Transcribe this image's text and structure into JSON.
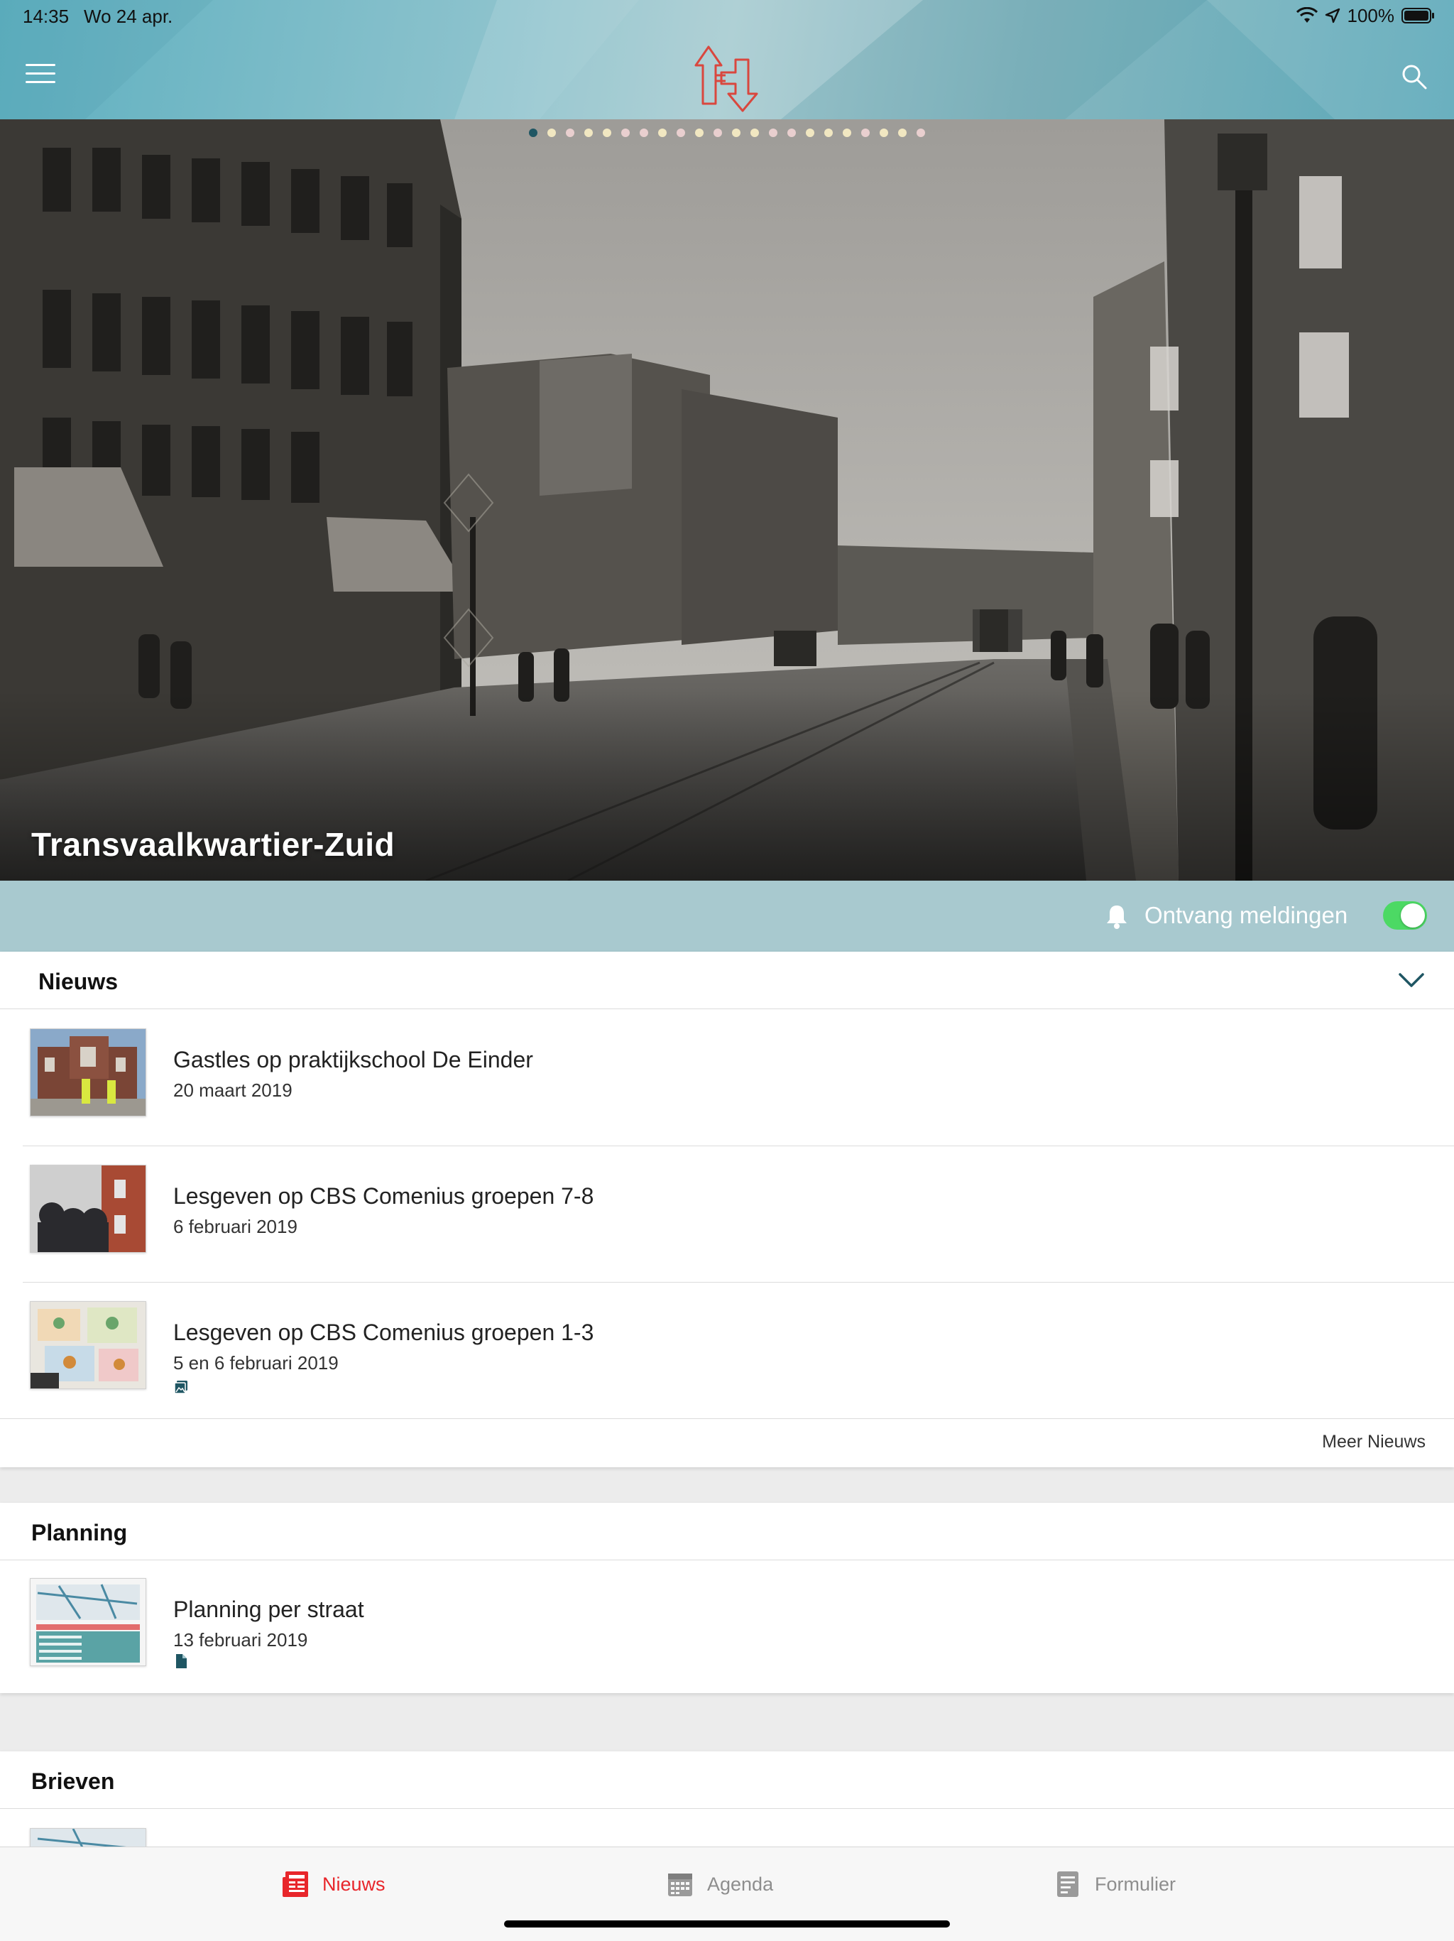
{
  "status": {
    "time": "14:35",
    "date": "Wo 24 apr.",
    "battery": "100%"
  },
  "header": {
    "menu_icon": "hamburger-icon",
    "logo": "h-arrow-logo",
    "search_icon": "search-icon"
  },
  "hero": {
    "title": "Transvaalkwartier-Zuid",
    "slide_count": 22,
    "active_slide": 1
  },
  "notifications": {
    "label": "Ontvang meldingen",
    "enabled": true
  },
  "news": {
    "title": "Nieuws",
    "items": [
      {
        "title": "Gastles op praktijkschool De Einder",
        "date": "20 maart 2019"
      },
      {
        "title": "Lesgeven op CBS Comenius groepen 7-8",
        "date": "6 februari 2019"
      },
      {
        "title": "Lesgeven op CBS Comenius groepen 1-3",
        "date": "5 en 6 februari 2019",
        "attachment_icon": "image-icon"
      }
    ],
    "more": "Meer Nieuws"
  },
  "planning": {
    "title": "Planning",
    "items": [
      {
        "title": "Planning per straat",
        "date": "13 februari 2019",
        "attachment_icon": "document-icon"
      }
    ]
  },
  "letters": {
    "title": "Brieven"
  },
  "tabs": [
    {
      "label": "Nieuws",
      "icon": "newspaper-icon",
      "active": true
    },
    {
      "label": "Agenda",
      "icon": "calendar-icon",
      "active": false
    },
    {
      "label": "Formulier",
      "icon": "form-icon",
      "active": false
    }
  ],
  "colors": {
    "accent": "#e8262b",
    "header_teal": "#6fb4c2",
    "notif_bar": "#a8c9cf",
    "toggle_on": "#4cd964",
    "icon_dark_teal": "#1f5663"
  }
}
